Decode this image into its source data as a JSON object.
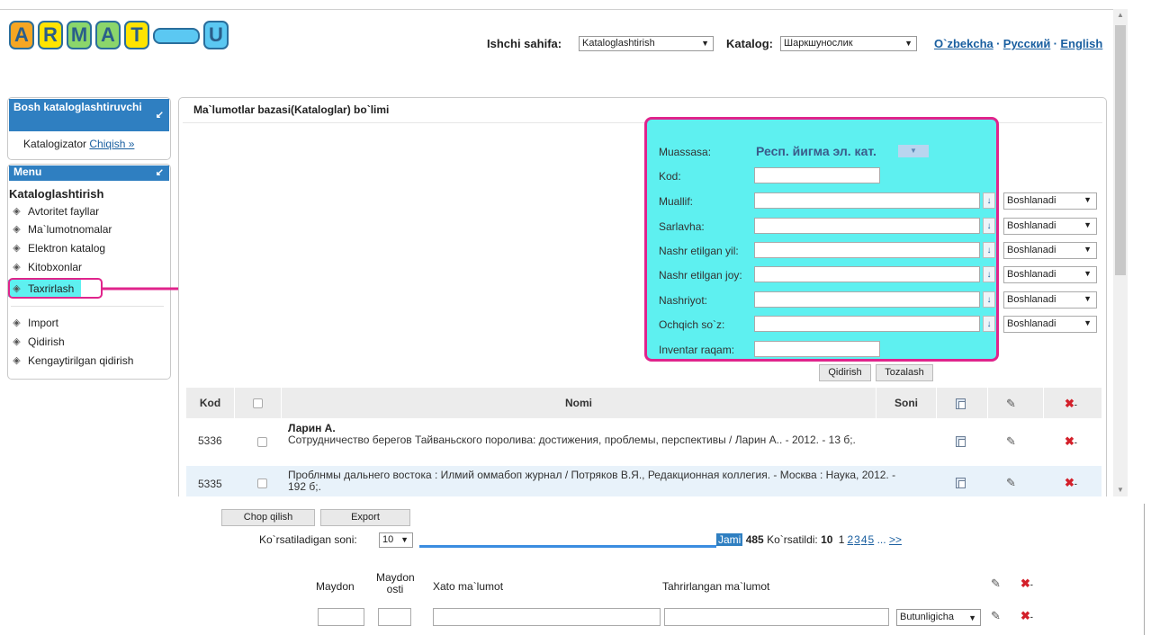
{
  "logo": {
    "letters": [
      "A",
      "R",
      "M",
      "A",
      "T",
      "U"
    ],
    "colors": [
      "#f5a623",
      "#ffe400",
      "#8bd66b",
      "#8bd66b",
      "#ffe400",
      "#5bc8f2"
    ]
  },
  "header": {
    "ishchi_label": "Ishchi sahifa:",
    "ishchi_value": "Kataloglashtirish",
    "katalog_label": "Katalog:",
    "katalog_value": "Шаркшунослик",
    "langs": [
      "O`zbekcha",
      "Русский",
      "English"
    ],
    "sep": "·"
  },
  "sidebar": {
    "user_panel_title": "Bosh kataloglashtiruvchi",
    "user_role": "Katalogizator",
    "logout": "Chiqish »",
    "menu_title": "Menu",
    "section": "Kataloglashtirish",
    "items": [
      "Avtoritet fayllar",
      "Ma`lumotnomalar",
      "Elektron katalog",
      "Kitobxonlar",
      "Taxrirlash"
    ],
    "items2": [
      "Import",
      "Qidirish",
      "Kengaytirilgan qidirish"
    ],
    "highlight_color": "#e0248c"
  },
  "main": {
    "title": "Ma`lumotlar bazasi(Kataloglar) bo`limi",
    "form": {
      "bg": "#5ef0f0",
      "muassasa_label": "Muassasa:",
      "muassasa_value": "Респ. йигма эл. кат.",
      "kod_label": "Kod:",
      "fields": [
        "Muallif:",
        "Sarlavha:",
        "Nashr etilgan yil:",
        "Nashr etilgan joy:",
        "Nashriyot:",
        "Ochqich so`z:"
      ],
      "match_option": "Boshlanadi",
      "inventar_label": "Inventar raqam:",
      "search_btn": "Qidirish",
      "clear_btn": "Tozalash"
    },
    "table": {
      "headers": {
        "kod": "Kod",
        "nomi": "Nomi",
        "soni": "Soni"
      },
      "rows": [
        {
          "kod": "5336",
          "author": "Ларин А.",
          "text": "Сотрудничество берегов Тайваньского поролива: достижения, проблемы, перспективы / Ларин А.. - 2012. - 13 б;."
        },
        {
          "kod": "5335",
          "author": "",
          "text": "Проблнмы дальнего востока : Илмий оммабоп журнал / Потряков В.Я., Редакционная коллегия. - Москва : Наука, 2012. - 192 б;."
        }
      ]
    }
  },
  "bottom": {
    "print_btn": "Chop qilish",
    "export_btn": "Export",
    "per_page_label": "Ko`rsatiladigan soni:",
    "per_page_value": "10",
    "jami_label": "Jami",
    "jami_value": "485",
    "shown_label": "Ko`rsatildi:",
    "shown_value": "10",
    "pages": [
      "1",
      "2",
      "3",
      "4",
      "5"
    ],
    "ellipsis": "...",
    "next": ">>",
    "edit": {
      "maydon": "Maydon",
      "maydon_osti": "Maydon osti",
      "xato": "Xato ma`lumot",
      "tahrir": "Tahrirlangan ma`lumot",
      "mode_value": "Butunligicha"
    }
  }
}
